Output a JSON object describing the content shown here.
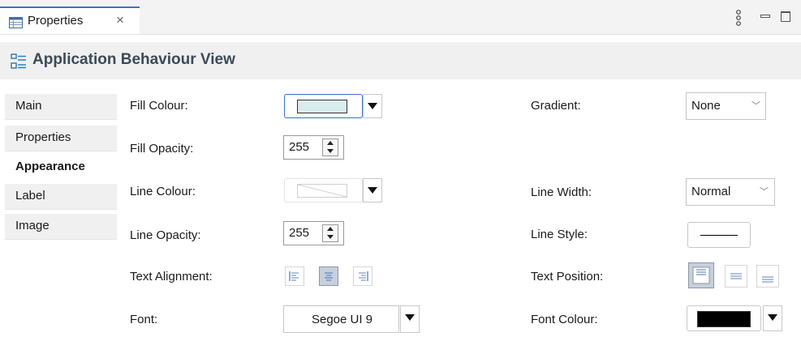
{
  "tab": {
    "label": "Properties",
    "close": "×"
  },
  "header": {
    "title": "Application Behaviour View"
  },
  "sidebar": {
    "items": [
      {
        "label": "Main",
        "active": false
      },
      {
        "label": "Properties",
        "active": false
      },
      {
        "label": "Appearance",
        "active": true
      },
      {
        "label": "Label",
        "active": false
      },
      {
        "label": "Image",
        "active": false
      }
    ]
  },
  "form": {
    "fill_colour_label": "Fill Colour:",
    "fill_colour_value": "#d9ecee",
    "gradient_label": "Gradient:",
    "gradient_value": "None",
    "fill_opacity_label": "Fill Opacity:",
    "fill_opacity_value": "255",
    "line_colour_label": "Line Colour:",
    "line_width_label": "Line Width:",
    "line_width_value": "Normal",
    "line_opacity_label": "Line Opacity:",
    "line_opacity_value": "255",
    "line_style_label": "Line Style:",
    "text_alignment_label": "Text Alignment:",
    "text_alignment_options": [
      "left",
      "center",
      "right"
    ],
    "text_alignment_selected": "center",
    "text_position_label": "Text Position:",
    "text_position_options": [
      "top",
      "middle",
      "bottom"
    ],
    "text_position_selected": "top",
    "font_label": "Font:",
    "font_value": "Segoe UI 9",
    "font_colour_label": "Font Colour:",
    "font_colour_value": "#000000"
  },
  "colors": {
    "accent": "#3b6fd1",
    "header_text": "#3c4a58"
  }
}
